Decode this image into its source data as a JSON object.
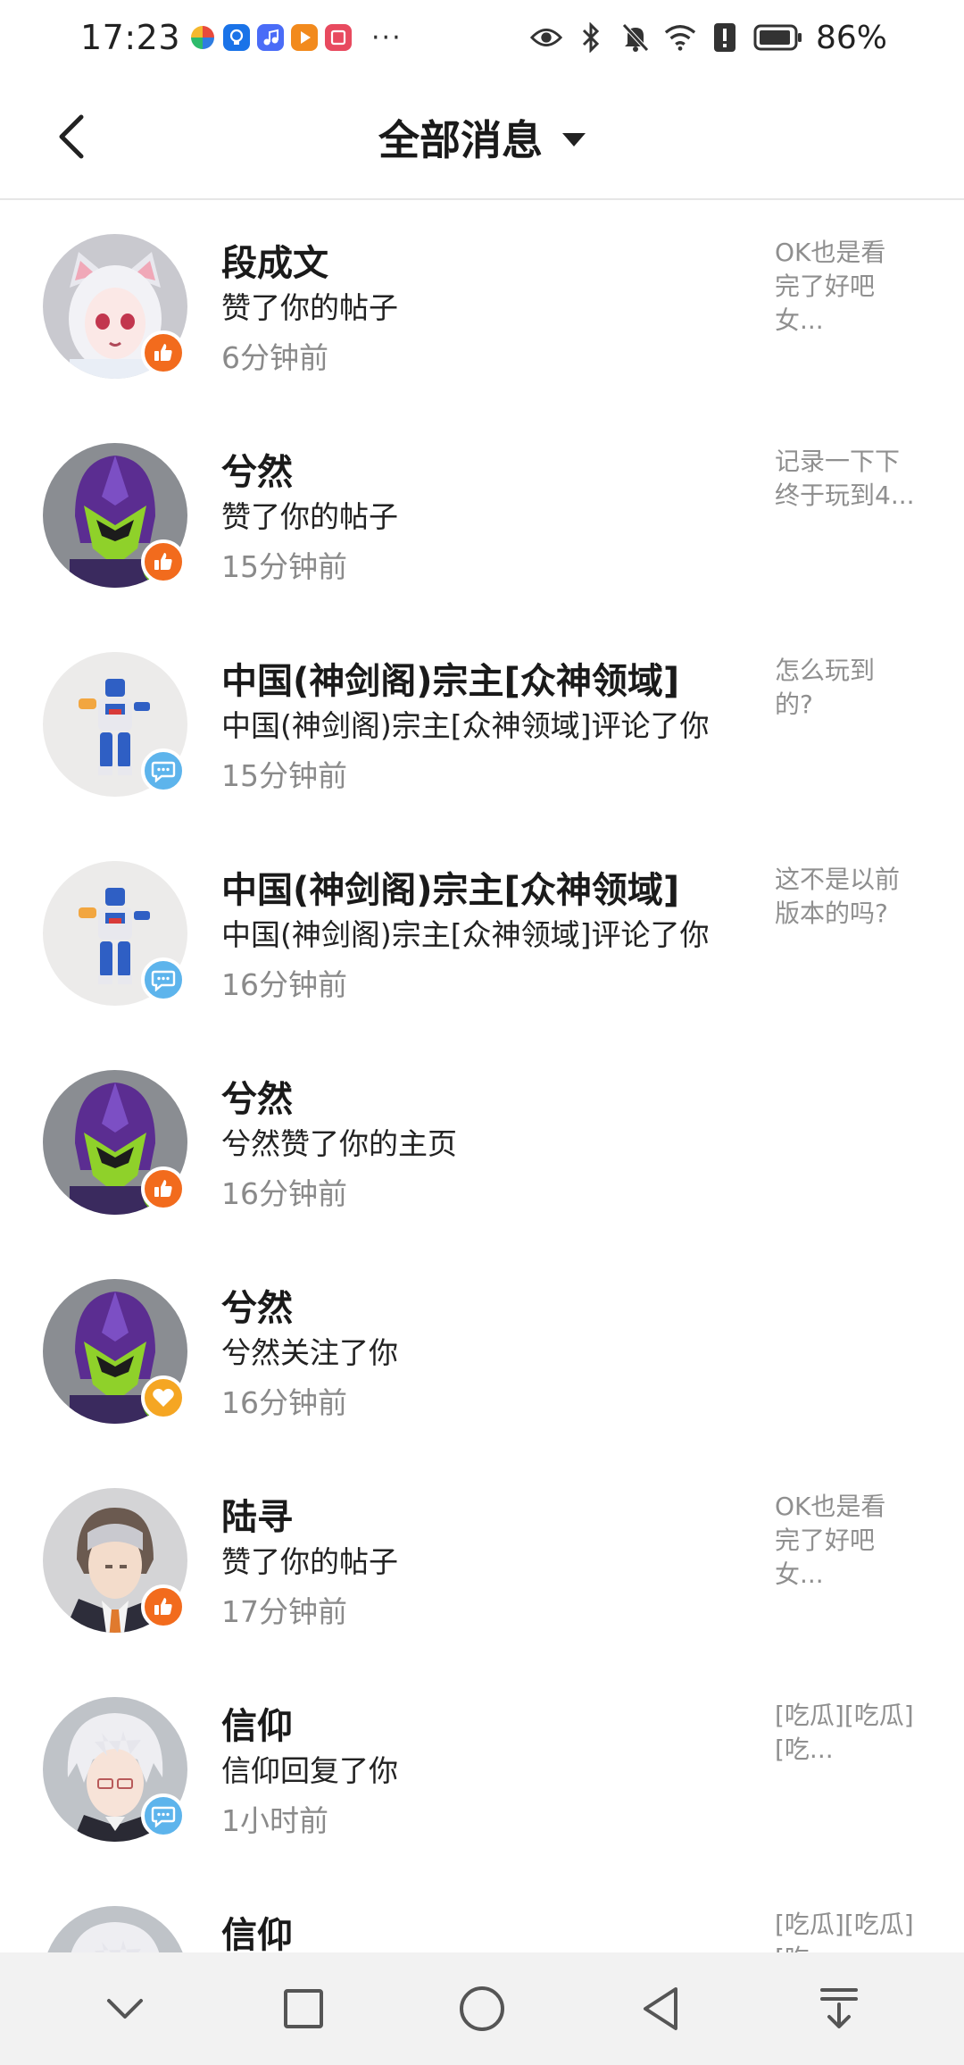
{
  "status_bar": {
    "time": "17:23",
    "more": "···",
    "battery": "86%"
  },
  "header": {
    "title": "全部消息"
  },
  "messages": [
    {
      "name": "段成文",
      "action": "赞了你的帖子",
      "time": "6分钟前",
      "preview": "OK也是看\n完了好吧\n女...",
      "badge": "like",
      "avatar": "catgirl"
    },
    {
      "name": "兮然",
      "action": "赞了你的帖子",
      "time": "15分钟前",
      "preview": "记录一下下\n终于玩到4...",
      "badge": "like",
      "avatar": "helmet"
    },
    {
      "name": "中国(神剑阁)宗主[众神领域]",
      "action": "中国(神剑阁)宗主[众神领域]评论了你",
      "time": "15分钟前",
      "preview": "怎么玩到\n的?",
      "badge": "comment",
      "avatar": "robot"
    },
    {
      "name": "中国(神剑阁)宗主[众神领域]",
      "action": "中国(神剑阁)宗主[众神领域]评论了你",
      "time": "16分钟前",
      "preview": "这不是以前\n版本的吗?",
      "badge": "comment",
      "avatar": "robot"
    },
    {
      "name": "兮然",
      "action": "兮然赞了你的主页",
      "time": "16分钟前",
      "preview": "",
      "badge": "like",
      "avatar": "helmet"
    },
    {
      "name": "兮然",
      "action": "兮然关注了你",
      "time": "16分钟前",
      "preview": "",
      "badge": "follow",
      "avatar": "helmet"
    },
    {
      "name": "陆寻",
      "action": "赞了你的帖子",
      "time": "17分钟前",
      "preview": "OK也是看\n完了好吧\n女...",
      "badge": "like",
      "avatar": "suit"
    },
    {
      "name": "信仰",
      "action": "信仰回复了你",
      "time": "1小时前",
      "preview": "[吃瓜][吃瓜]\n[吃...",
      "badge": "comment",
      "avatar": "whitehair"
    },
    {
      "name": "信仰",
      "action": "",
      "time": "",
      "preview": "[吃瓜][吃瓜]\n[吃...",
      "badge": "comment",
      "avatar": "whitehair"
    }
  ],
  "colors": {
    "like_badge": "#f26b1d",
    "comment_badge": "#5db4ec",
    "follow_badge": "#f5a623",
    "secondary_text": "#8a8a8a"
  }
}
